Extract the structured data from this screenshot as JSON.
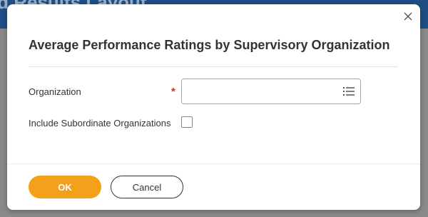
{
  "background": {
    "page_title": "rd Results Layout"
  },
  "dialog": {
    "title": "Average Performance Ratings by Supervisory Organization",
    "close_icon": "close-icon"
  },
  "fields": {
    "organization": {
      "label": "Organization",
      "required_marker": "*",
      "value": "",
      "placeholder": "",
      "icon": "prompt-list-icon"
    },
    "include_subordinates": {
      "label": "Include Subordinate Organizations",
      "checked": false
    }
  },
  "footer": {
    "ok_label": "OK",
    "cancel_label": "Cancel"
  },
  "colors": {
    "accent": "#f5a01a",
    "required": "#de2e21",
    "header_bg": "#1f4e86",
    "text": "#333333"
  }
}
